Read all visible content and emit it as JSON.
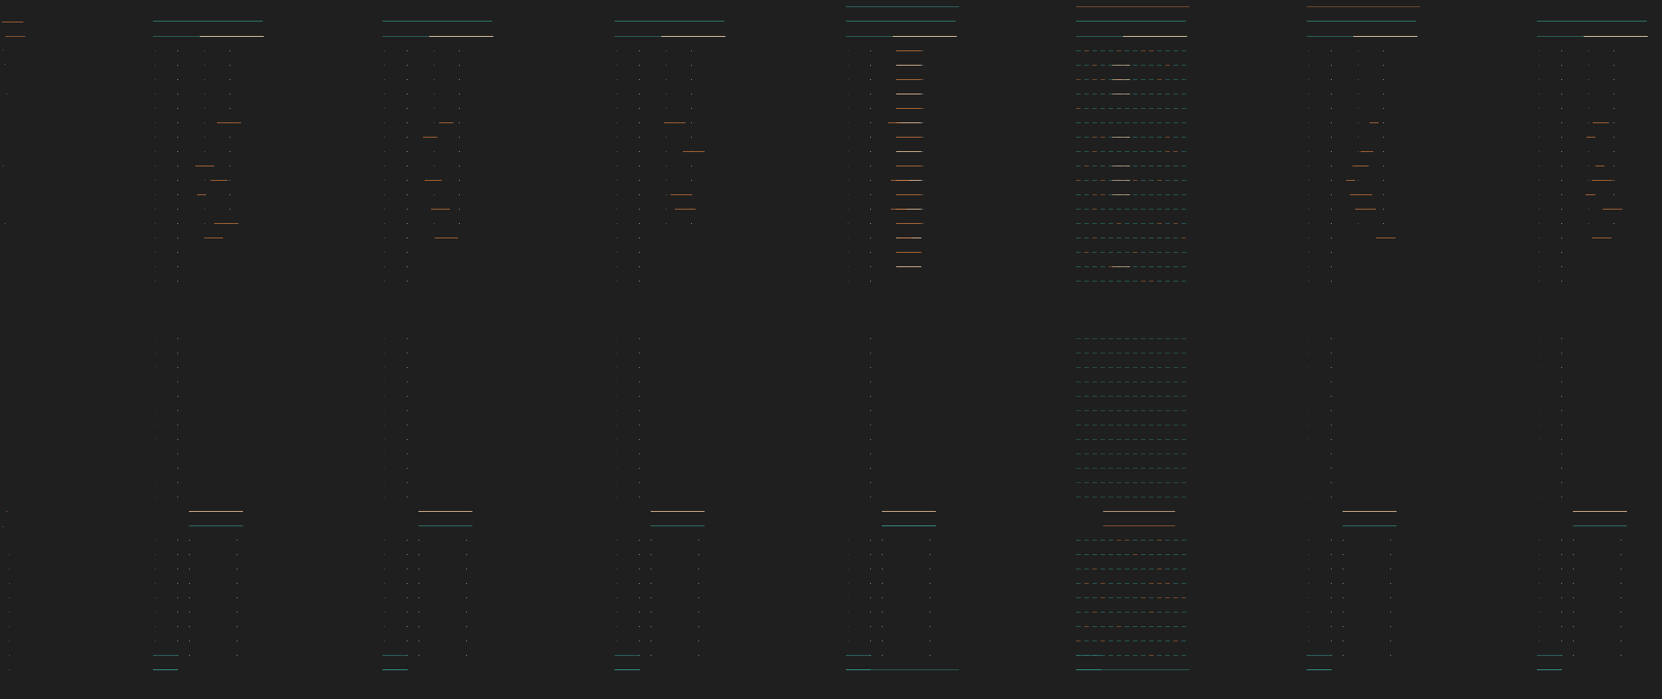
{
  "screen": {
    "background": "#1f1f1f",
    "description_visible_text": []
  },
  "palette": {
    "teal": "#2f8f84",
    "teal_bright": "#3fb5a6",
    "orange": "#c8733a",
    "orange_bright": "#e0874a",
    "peach": "#f0c8a0",
    "white": "#d8d8d8",
    "gray": "#7a7a7a",
    "dim": "#4a4a4a"
  },
  "panes": [
    {
      "id": "pane-0",
      "style": "partial",
      "has_top_band": false
    },
    {
      "id": "pane-1",
      "style": "standard",
      "has_top_band": true
    },
    {
      "id": "pane-2",
      "style": "standard",
      "has_top_band": true
    },
    {
      "id": "pane-3",
      "style": "standard",
      "has_top_band": true
    },
    {
      "id": "pane-4",
      "style": "dense-left",
      "has_top_band": true
    },
    {
      "id": "pane-5",
      "style": "grid",
      "has_top_band": true
    },
    {
      "id": "pane-6",
      "style": "standard",
      "has_top_band": true
    },
    {
      "id": "pane-7",
      "style": "standard",
      "has_top_band": true
    }
  ]
}
